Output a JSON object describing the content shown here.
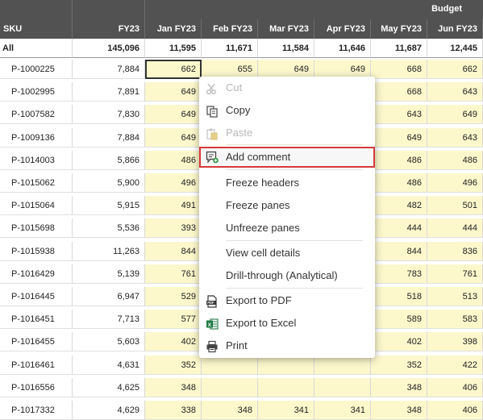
{
  "header": {
    "group_label": "Budget",
    "columns": [
      "SKU",
      "FY23",
      "Jan FY23",
      "Feb FY23",
      "Mar FY23",
      "Apr FY23",
      "May FY23",
      "Jun FY23"
    ]
  },
  "total_row": [
    "All",
    "145,096",
    "11,595",
    "11,671",
    "11,584",
    "11,646",
    "11,687",
    "12,445"
  ],
  "rows": [
    [
      "P-1000225",
      "7,884",
      "662",
      "655",
      "649",
      "649",
      "668",
      "662"
    ],
    [
      "P-1002995",
      "7,891",
      "649",
      "",
      "",
      "",
      "668",
      "643"
    ],
    [
      "P-1007582",
      "7,830",
      "649",
      "",
      "",
      "",
      "643",
      "649"
    ],
    [
      "P-1009136",
      "7,884",
      "649",
      "",
      "",
      "",
      "649",
      "643"
    ],
    [
      "P-1014003",
      "5,866",
      "486",
      "",
      "",
      "",
      "486",
      "486"
    ],
    [
      "P-1015062",
      "5,900",
      "496",
      "",
      "",
      "",
      "486",
      "496"
    ],
    [
      "P-1015064",
      "5,915",
      "491",
      "",
      "",
      "",
      "482",
      "501"
    ],
    [
      "P-1015698",
      "5,536",
      "393",
      "",
      "",
      "",
      "444",
      "444"
    ],
    [
      "P-1015938",
      "11,263",
      "844",
      "",
      "",
      "",
      "844",
      "836"
    ],
    [
      "P-1016429",
      "5,139",
      "761",
      "",
      "",
      "",
      "783",
      "761"
    ],
    [
      "P-1016445",
      "6,947",
      "529",
      "",
      "",
      "",
      "518",
      "513"
    ],
    [
      "P-1016451",
      "7,713",
      "577",
      "",
      "",
      "",
      "589",
      "583"
    ],
    [
      "P-1016455",
      "5,603",
      "402",
      "",
      "",
      "",
      "402",
      "398"
    ],
    [
      "P-1016461",
      "4,631",
      "352",
      "",
      "",
      "",
      "352",
      "422"
    ],
    [
      "P-1016556",
      "4,625",
      "348",
      "",
      "",
      "",
      "348",
      "406"
    ],
    [
      "P-1017332",
      "4,629",
      "338",
      "348",
      "341",
      "341",
      "348",
      "406"
    ]
  ],
  "context_menu": {
    "items": [
      {
        "label": "Cut",
        "icon": "scissors-icon",
        "disabled": true
      },
      {
        "label": "Copy",
        "icon": "copy-icon",
        "disabled": false
      },
      {
        "label": "Paste",
        "icon": "paste-icon",
        "disabled": true
      },
      {
        "label": "Add comment",
        "icon": "add-comment-icon",
        "disabled": false,
        "highlighted": true
      },
      {
        "label": "Freeze headers",
        "icon": "",
        "disabled": false
      },
      {
        "label": "Freeze panes",
        "icon": "",
        "disabled": false
      },
      {
        "label": "Unfreeze panes",
        "icon": "",
        "disabled": false
      },
      {
        "label": "View cell details",
        "icon": "",
        "disabled": false
      },
      {
        "label": "Drill-through (Analytical)",
        "icon": "",
        "disabled": false
      },
      {
        "label": "Export to PDF",
        "icon": "pdf-icon",
        "disabled": false
      },
      {
        "label": "Export to Excel",
        "icon": "excel-icon",
        "disabled": false
      },
      {
        "label": "Print",
        "icon": "printer-icon",
        "disabled": false
      }
    ]
  },
  "colors": {
    "header_bg": "#525252",
    "budget_cell_bg": "#fcf8cc",
    "highlight_border": "#d63a3a",
    "excel_green": "#1e7b45"
  }
}
